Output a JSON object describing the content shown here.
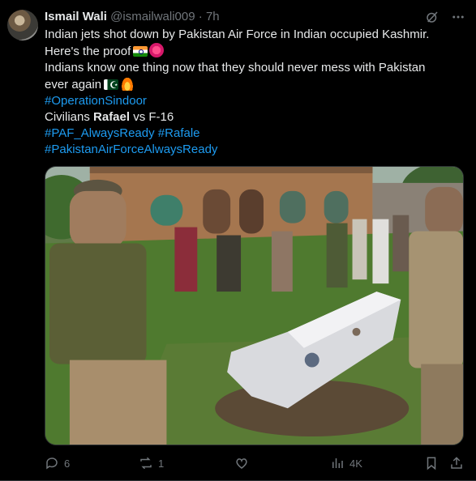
{
  "tweet": {
    "author_name": "Ismail Wali",
    "author_handle": "@ismailwali009",
    "separator": "·",
    "time": "7h",
    "lines": {
      "l1": "Indian jets shot down by Pakistan Air Force in Indian occupied Kashmir.",
      "l2": "Here's the proof",
      "l3": "Indians know one thing now that they should never mess with Pakistan",
      "l4": "ever again",
      "l5_tag": "#OperationSindoor",
      "l6_a": "Civilians ",
      "l6_b": "Rafael",
      "l6_c": " vs F-16",
      "l7_tag1": "#PAF_AlwaysReady",
      "l7_tag2": "#Rafale",
      "l8_tag": "#PakistanAirForceAlwaysReady"
    },
    "emojis": [
      "flag-india",
      "pink-heart",
      "flag-pakistan",
      "fire"
    ]
  },
  "actions": {
    "reply_count": "6",
    "retweet_count": "1",
    "like_count": "",
    "views_count": "4K"
  },
  "icons": [
    "grok-icon",
    "more-icon",
    "reply-icon",
    "retweet-icon",
    "like-icon",
    "views-icon",
    "bookmark-icon",
    "share-icon"
  ],
  "colors": {
    "background": "#000000",
    "text": "#e7e9ea",
    "muted": "#71767b",
    "link": "#1d9bf0"
  }
}
